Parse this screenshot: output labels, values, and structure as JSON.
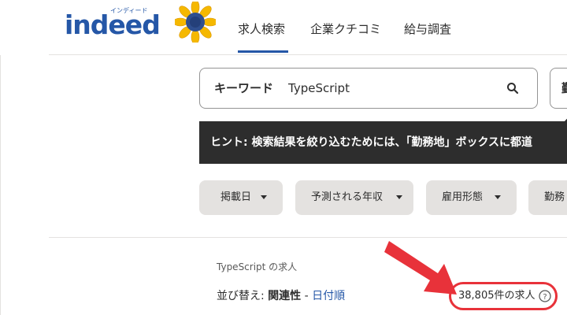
{
  "header": {
    "logo_text": "indeed",
    "logo_kana": "インディード",
    "nav": [
      "求人検索",
      "企業クチコミ",
      "給与調査"
    ]
  },
  "search": {
    "keyword_label": "キーワード",
    "keyword_value": "TypeScript",
    "location_label": "勤"
  },
  "hint": {
    "text": "ヒント: 検索結果を絞り込むためには、「勤務地」ボックスに都道"
  },
  "filters": [
    "掲載日",
    "予測される年収",
    "雇用形態",
    "勤務"
  ],
  "results": {
    "title": "TypeScript の求人",
    "sort_prefix": "並び替え: ",
    "sort_active": "関連性",
    "sort_separator": " - ",
    "sort_link": "日付順",
    "count": "38,805件の求人",
    "help_symbol": "?"
  },
  "colors": {
    "brand_blue": "#2557a7",
    "highlight_red": "#e8323a",
    "filter_bg": "#e4e2e0",
    "hint_bg": "#2d2d2d"
  }
}
